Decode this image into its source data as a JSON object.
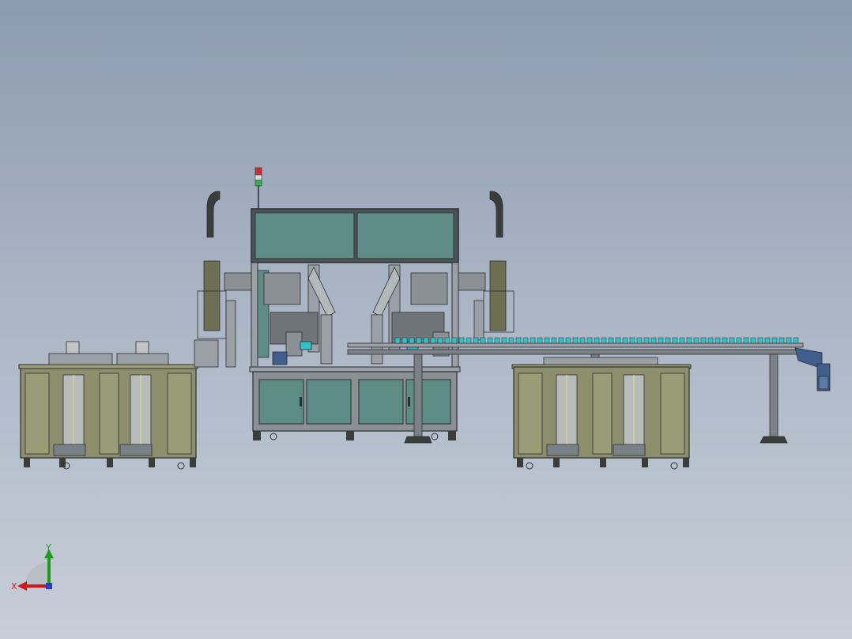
{
  "viewport": {
    "colors": {
      "bg_top": "#8d9bb1",
      "bg_bottom": "#c7ced8"
    }
  },
  "model": {
    "colors": {
      "cabinet": "#8d8f6c",
      "cabinet_dark": "#6d6f52",
      "panel_teal": "#5e8c86",
      "panel_teal_light": "#6f9e97",
      "frame_gray": "#9aa0a5",
      "line_dark": "#2b2f33",
      "conveyor": "#7a8288",
      "parts_cyan": "#2ec4c7",
      "arm_black": "#3a3d3a",
      "motor_blue": "#3f5e8c",
      "signal_red": "#d22a2a",
      "signal_green": "#36b04a"
    }
  },
  "triad": {
    "x_label": "X",
    "y_label": "Y",
    "x_color": "#d01818",
    "y_color": "#18a018"
  }
}
